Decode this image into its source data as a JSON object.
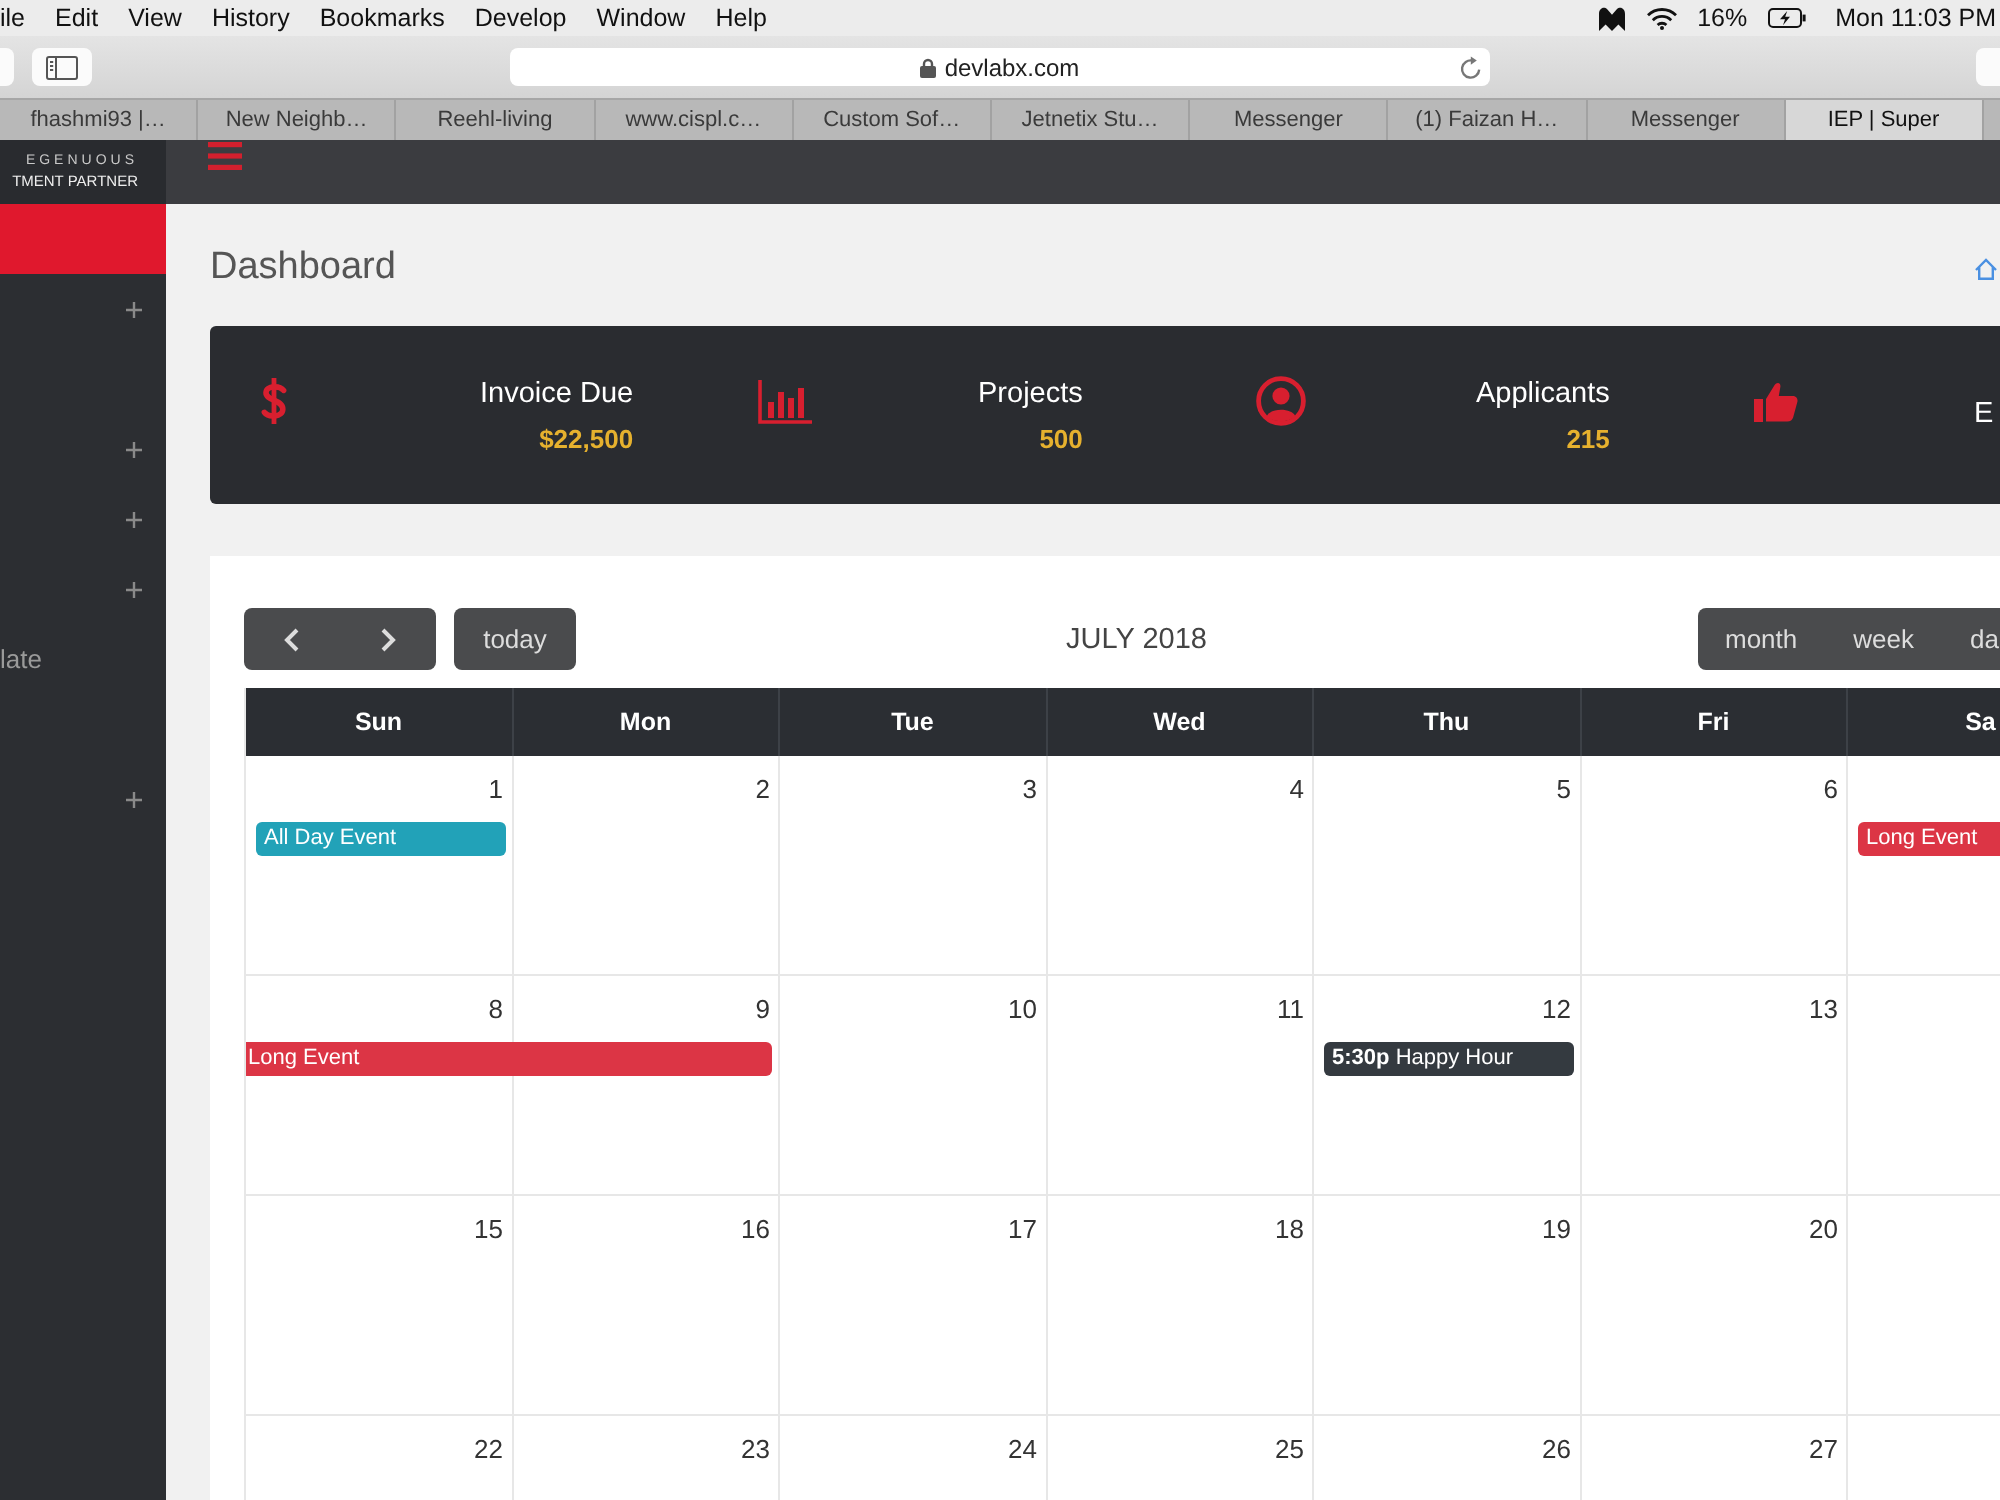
{
  "menu_bar": {
    "menus": [
      "ile",
      "Edit",
      "View",
      "History",
      "Bookmarks",
      "Develop",
      "Window",
      "Help"
    ],
    "battery": "16%",
    "clock": "Mon 11:03 PM"
  },
  "browser": {
    "address": "devlabx.com",
    "tabs": [
      {
        "title": "fhashmi93 |…",
        "selected": false
      },
      {
        "title": "New Neighb…",
        "selected": false
      },
      {
        "title": "Reehl-living",
        "selected": false
      },
      {
        "title": "www.cispl.c…",
        "selected": false
      },
      {
        "title": "Custom Sof…",
        "selected": false
      },
      {
        "title": "Jetnetix Stu…",
        "selected": false
      },
      {
        "title": "Messenger",
        "selected": false
      },
      {
        "title": "(1) Faizan H…",
        "selected": false
      },
      {
        "title": "Messenger",
        "selected": false
      },
      {
        "title": "IEP | Super",
        "selected": true
      }
    ]
  },
  "app_header": {
    "logo": [
      "EGENUOUS",
      "TMENT PARTNER"
    ]
  },
  "sidebar": {
    "items": [
      {
        "selected": true,
        "expandable": false
      },
      {
        "selected": false,
        "expandable": true
      },
      {
        "selected": false,
        "expandable": false
      },
      {
        "selected": false,
        "expandable": true
      },
      {
        "selected": false,
        "expandable": true
      },
      {
        "selected": false,
        "expandable": true
      },
      {
        "label": "late",
        "selected": false,
        "expandable": false
      },
      {
        "selected": false,
        "expandable": false
      },
      {
        "selected": false,
        "expandable": true
      }
    ]
  },
  "page": {
    "title": "Dashboard"
  },
  "stats": [
    {
      "label": "Invoice Due",
      "value": "$22,500"
    },
    {
      "label": "Projects",
      "value": "500"
    },
    {
      "label": "Applicants",
      "value": "215"
    },
    {
      "label": "E"
    }
  ],
  "calendar": {
    "title": "JULY 2018",
    "today_button": "today",
    "views": [
      "month",
      "week",
      "da"
    ],
    "weekdays": [
      "Sun",
      "Mon",
      "Tue",
      "Wed",
      "Thu",
      "Fri",
      "Sa"
    ],
    "weeks": [
      {
        "cells": [
          {
            "date": "1",
            "events": [
              {
                "kind": "all-day",
                "title": "All Day Event",
                "color": "#22a2b8",
                "continues_before": false
              }
            ]
          },
          {
            "date": "2"
          },
          {
            "date": "3"
          },
          {
            "date": "4"
          },
          {
            "date": "5"
          },
          {
            "date": "6"
          },
          {
            "events": [
              {
                "kind": "all-day",
                "title": "Long Event",
                "color": "#dc3545",
                "continues_before": false
              }
            ]
          }
        ]
      },
      {
        "cells": [
          {
            "date": "8",
            "events": [
              {
                "kind": "all-day",
                "title": "Long Event",
                "color": "#dc3545",
                "continues_before": true
              }
            ]
          },
          {
            "date": "9",
            "events": [
              {
                "kind": "continuation"
              }
            ]
          },
          {
            "date": "10"
          },
          {
            "date": "11"
          },
          {
            "date": "12",
            "events": [
              {
                "kind": "timed",
                "time": "5:30p",
                "title": "Happy Hour",
                "color": "#343a40",
                "continues_before": false
              }
            ]
          },
          {
            "date": "13"
          }
        ]
      },
      {
        "cells": [
          {
            "date": "15"
          },
          {
            "date": "16"
          },
          {
            "date": "17"
          },
          {
            "date": "18"
          },
          {
            "date": "19"
          },
          {
            "date": "20"
          }
        ]
      },
      {
        "cells": [
          {
            "date": "22"
          },
          {
            "date": "23"
          },
          {
            "date": "24"
          },
          {
            "date": "25"
          },
          {
            "date": "26"
          },
          {
            "date": "27"
          }
        ]
      }
    ]
  }
}
